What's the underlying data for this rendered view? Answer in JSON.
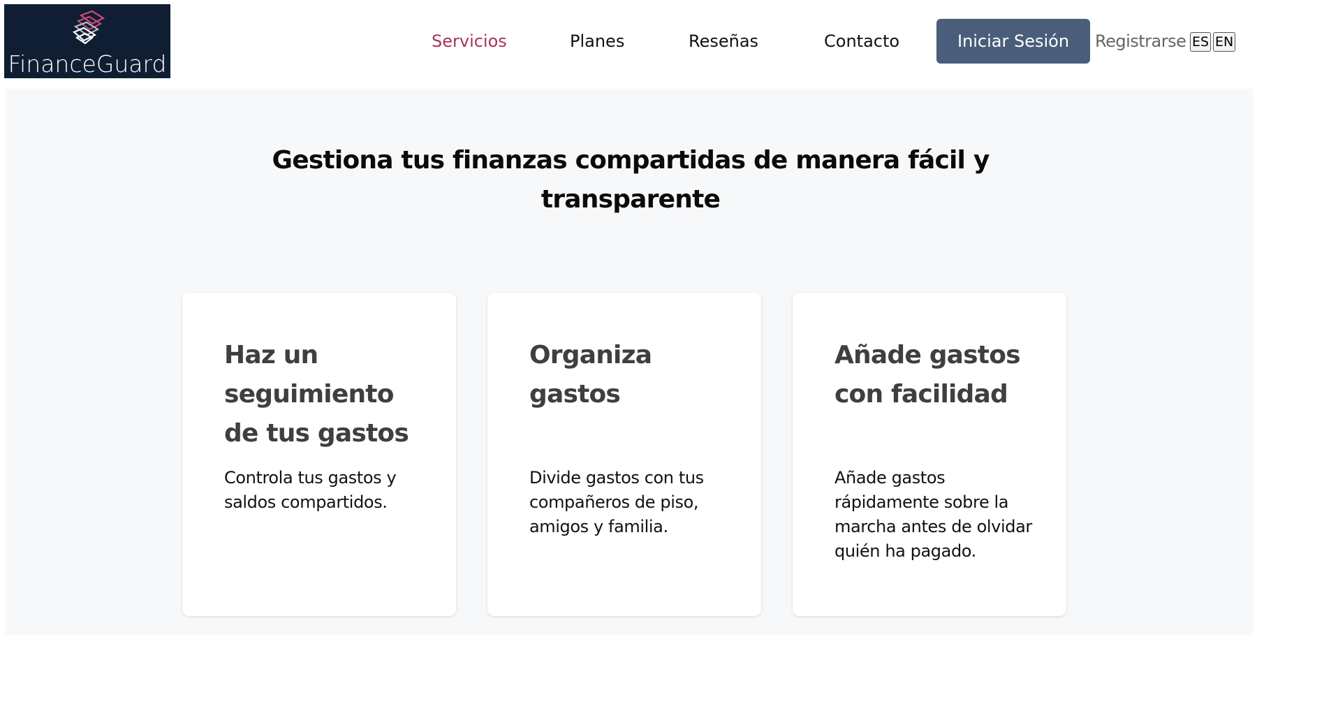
{
  "header": {
    "logo_text": "FinanceGuard",
    "brand_colors": {
      "logo_bg": "#0f1e33",
      "logo_mark": "#d14a7c",
      "active_link": "#a8325e",
      "login_button": "#4a5d7a"
    },
    "nav": [
      {
        "label": "Servicios",
        "active": true
      },
      {
        "label": "Planes",
        "active": false
      },
      {
        "label": "Reseñas",
        "active": false
      },
      {
        "label": "Contacto",
        "active": false
      }
    ],
    "login_label": "Iniciar Sesión",
    "register_label": "Registrarse",
    "languages": [
      "ES",
      "EN"
    ]
  },
  "hero": {
    "title": "Gestiona tus finanzas compartidas de manera fácil y transparente"
  },
  "cards": [
    {
      "title": "Haz un seguimiento de tus gastos",
      "description": "Controla tus gastos y saldos compartidos."
    },
    {
      "title": "Organiza gastos",
      "description": "Divide gastos con tus compañeros de piso, amigos y familia."
    },
    {
      "title": "Añade gastos con facilidad",
      "description": "Añade gastos rápidamente sobre la marcha antes de olvidar quién ha pagado."
    }
  ],
  "icons": {
    "logo": "stacked-layers-icon"
  }
}
